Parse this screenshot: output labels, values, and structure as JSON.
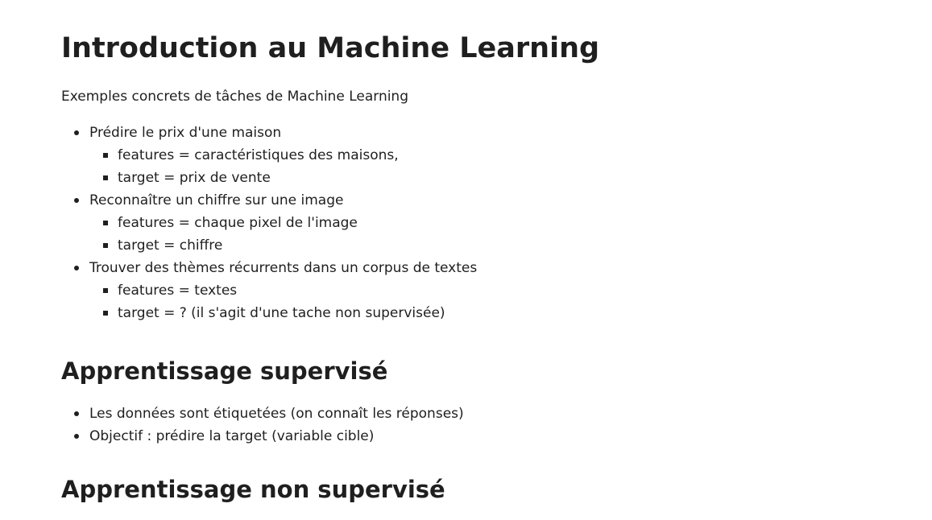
{
  "title": "Introduction au Machine Learning",
  "intro": "Exemples concrets de tâches de Machine Learning",
  "examples": [
    {
      "label": "Prédire le prix d'une maison",
      "sub": [
        "features = caractéristiques des maisons,",
        "target = prix de vente"
      ]
    },
    {
      "label": "Reconnaître un chiffre sur une image",
      "sub": [
        "features = chaque pixel de l'image",
        "target = chiffre"
      ]
    },
    {
      "label": "Trouver des thèmes récurrents dans un corpus de textes",
      "sub": [
        "features = textes",
        "target = ? (il s'agit d'une tache non supervisée)"
      ]
    }
  ],
  "supervised": {
    "title": "Apprentissage supervisé",
    "items": [
      "Les données sont étiquetées (on connaît les réponses)",
      "Objectif : prédire la target (variable cible)"
    ]
  },
  "unsupervised": {
    "title": "Apprentissage non supervisé"
  }
}
